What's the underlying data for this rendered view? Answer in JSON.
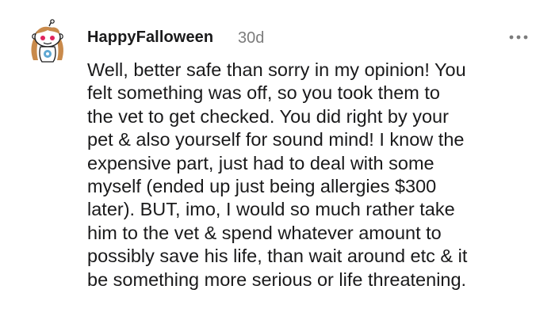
{
  "comment": {
    "username": "HappyFalloween",
    "timestamp": "30d",
    "more_icon": "more-horizontal-icon",
    "avatar_icon": "snoo-avatar-icon",
    "body_lines": [
      "Well, better safe than sorry in my opinion! You",
      "felt something was off, so you took them to",
      "the vet to get checked. You did right by your",
      "pet & also yourself for sound mind! I know the",
      "expensive part, just had to deal with some",
      "myself (ended up just being allergies $300",
      "later). BUT, imo, I would so much rather take",
      "him to the vet & spend whatever amount to",
      "possibly save his life, than wait around etc & it",
      "be something more serious or life threatening."
    ]
  },
  "colors": {
    "text": "#1a1a1b",
    "meta": "#7c7c7c",
    "avatar_hair": "#c98a4b",
    "avatar_eye": "#e0245e",
    "avatar_shirt": "#5fa8d3"
  }
}
